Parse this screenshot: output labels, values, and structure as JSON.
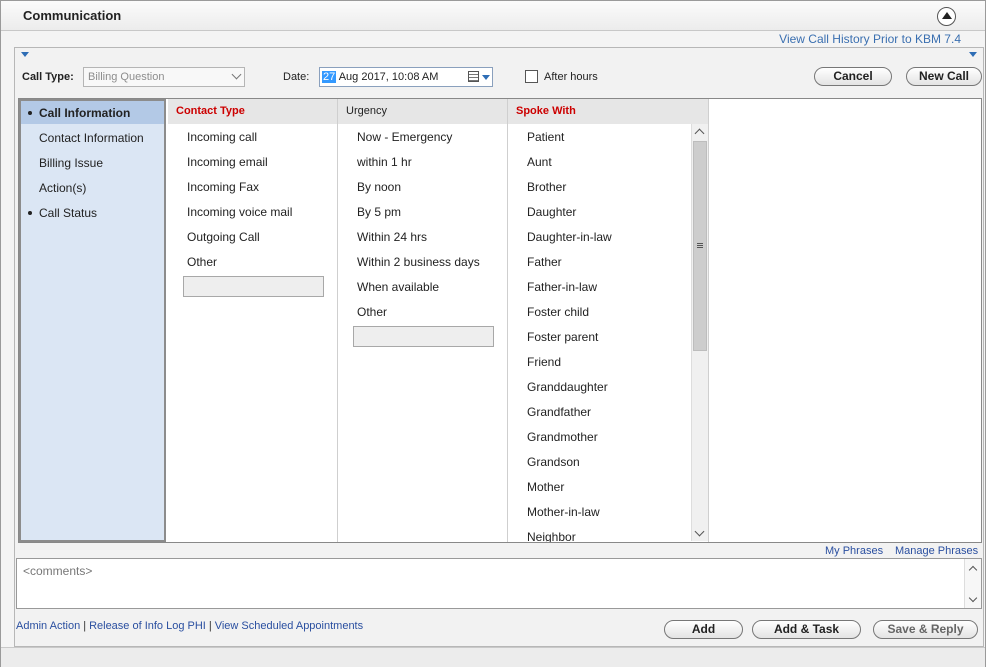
{
  "window": {
    "title": "Communication"
  },
  "header": {
    "history_link": "View Call History Prior to KBM 7.4"
  },
  "toolbar": {
    "call_type_label": "Call Type:",
    "call_type_value": "Billing Question",
    "date_label": "Date:",
    "date_day": "27",
    "date_rest": " Aug 2017, 10:08 AM",
    "after_hours_label": "After hours",
    "cancel_label": "Cancel",
    "new_call_label": "New Call"
  },
  "nav": {
    "items": [
      {
        "label": "Call Information",
        "bullet": true,
        "active": true
      },
      {
        "label": "Contact Information",
        "bullet": false,
        "active": false
      },
      {
        "label": "Billing Issue",
        "bullet": false,
        "active": false
      },
      {
        "label": "Action(s)",
        "bullet": false,
        "active": false
      },
      {
        "label": "Call Status",
        "bullet": true,
        "active": false
      }
    ]
  },
  "columns": {
    "contact_type": {
      "header": "Contact Type",
      "items": [
        "Incoming call",
        "Incoming email",
        "Incoming Fax",
        "Incoming voice mail",
        "Outgoing Call",
        "Other"
      ]
    },
    "urgency": {
      "header": "Urgency",
      "items": [
        "Now - Emergency",
        "within 1 hr",
        "By noon",
        "By 5 pm",
        "Within 24 hrs",
        "Within 2 business days",
        "When available",
        "Other"
      ]
    },
    "spoke_with": {
      "header": "Spoke With",
      "items": [
        "Patient",
        "Aunt",
        "Brother",
        "Daughter",
        "Daughter-in-law",
        "Father",
        "Father-in-law",
        "Foster child",
        "Foster parent",
        "Friend",
        "Granddaughter",
        "Grandfather",
        "Grandmother",
        "Grandson",
        "Mother",
        "Mother-in-law",
        "Neighbor"
      ]
    }
  },
  "phrases": {
    "my_phrases": "My Phrases",
    "manage_phrases": "Manage Phrases"
  },
  "comments": {
    "placeholder": "<comments>"
  },
  "footer": {
    "links": [
      "Admin Action",
      "Release of Info Log PHI",
      "View Scheduled Appointments"
    ],
    "add_label": "Add",
    "add_task_label": "Add & Task",
    "save_reply_label": "Save & Reply"
  }
}
